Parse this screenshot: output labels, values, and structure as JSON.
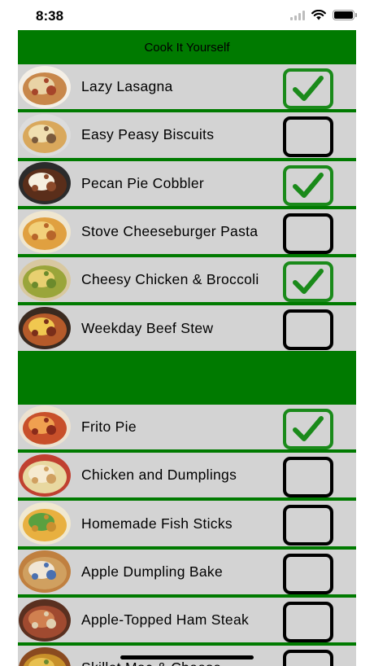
{
  "status_bar": {
    "time": "8:38"
  },
  "header": {
    "title": "Cook It Yourself"
  },
  "section1": [
    {
      "label": "Lazy Lasagna",
      "checked": true
    },
    {
      "label": "Easy Peasy Biscuits",
      "checked": false
    },
    {
      "label": "Pecan Pie Cobbler",
      "checked": true
    },
    {
      "label": "Stove Cheeseburger Pasta",
      "checked": false
    },
    {
      "label": "Cheesy Chicken & Broccoli",
      "checked": true
    },
    {
      "label": "Weekday Beef Stew",
      "checked": false
    }
  ],
  "section2": [
    {
      "label": "Frito Pie",
      "checked": true
    },
    {
      "label": "Chicken and Dumplings",
      "checked": false
    },
    {
      "label": "Homemade Fish Sticks",
      "checked": false
    },
    {
      "label": "Apple Dumpling Bake",
      "checked": false
    },
    {
      "label": "Apple-Topped Ham Steak",
      "checked": false
    },
    {
      "label": "Skillet Mac & Cheese",
      "checked": false
    }
  ],
  "colors": {
    "green": "#007a00",
    "row_bg": "#d3d3d3",
    "check_green": "#1a8a1a"
  }
}
